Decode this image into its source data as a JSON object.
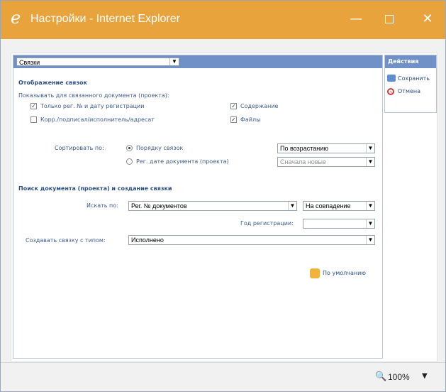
{
  "window": {
    "title": "Настройки - Internet Explorer",
    "buttons": {
      "minimize": "—",
      "maximize": "",
      "close": "✕"
    },
    "icon": "internet-explorer-logo"
  },
  "header_select": {
    "value": "Связки"
  },
  "links_section": {
    "title": "Отображение связок",
    "subtitle": "Показывать для связанного документа (проекта):",
    "checkboxes": [
      {
        "label": "Только рег. № и дату регистрации",
        "checked": true
      },
      {
        "label": "Корр./подписал/исполнитель/адресат",
        "checked": false
      },
      {
        "label": "Содержание",
        "checked": true
      },
      {
        "label": "Файлы",
        "checked": true
      }
    ],
    "sort": {
      "label": "Сортировать по:",
      "options": [
        {
          "label": "Порядку связок",
          "selected": true
        },
        {
          "label": "Рег. дате документа (проекта)",
          "selected": false
        }
      ],
      "order1": "По возрастанию",
      "order2": "Сначала новые"
    }
  },
  "search_section": {
    "title": "Поиск документа (проекта) и создание связки",
    "search_by_label": "Искать по:",
    "search_by_value": "Рег. № документов",
    "match_value": "На совпадение",
    "year_label": "Год регистрации:",
    "year_value": "",
    "create_link_label": "Создавать связку с типом:",
    "create_link_value": "Исполнено",
    "default_link": "По умолчанию"
  },
  "actions": {
    "title": "Действия",
    "save": "Сохранить",
    "cancel": "Отмена"
  },
  "statusbar": {
    "zoom": "100%",
    "zoom_icon": "zoom-icon",
    "menu_arrow": "▼"
  },
  "colors": {
    "title_bar": "#e8a33c",
    "panel_header": "#6f91c8",
    "text": "#1f3a6e"
  }
}
